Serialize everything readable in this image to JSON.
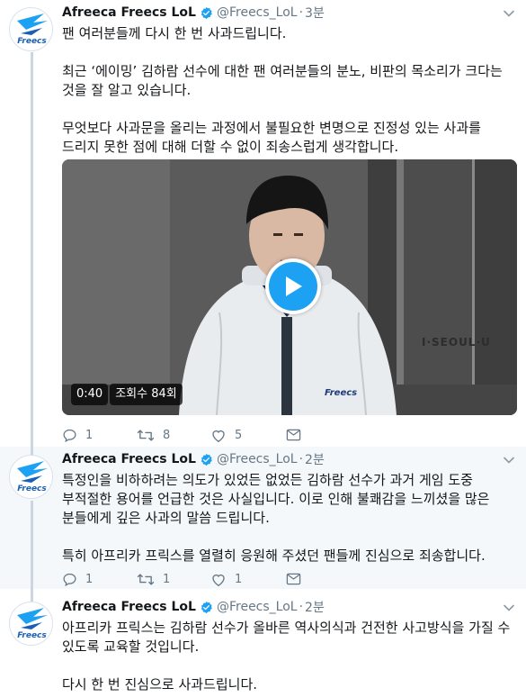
{
  "colors": {
    "accent": "#1da1f2",
    "verified": "#1da1f2",
    "thread_line": "#cbd6e2",
    "secondary_text": "#657786"
  },
  "account": {
    "name": "Afreeca Freecs LoL",
    "handle": "@Freecs_LoL",
    "logo_text": "Freecs"
  },
  "tweets": [
    {
      "time": "3분",
      "paragraphs": [
        "팬 여러분들께 다시 한 번 사과드립니다.",
        "최근 ‘에이밍’ 김하람 선수에 대한 팬 여러분들의 분노, 비판의 목소리가 크다는 것을 잘 알고 있습니다.",
        "무엇보다 사과문을 올리는 과정에서 불필요한 변명으로 진정성 있는 사과를 드리지 못한 점에 대해 더할 수 없이 죄송스럽게 생각합니다."
      ],
      "video": {
        "duration": "0:40",
        "views": "조회수 84회",
        "wall_sign": "I·SEOUL·U",
        "jacket_logo": "Freecs"
      },
      "replies": "1",
      "retweets": "8",
      "likes": "5"
    },
    {
      "time": "2분",
      "paragraphs": [
        "특정인을 비하하려는 의도가 있었든 없었든 김하람 선수가 과거 게임 도중 부적절한 용어를 언급한 것은 사실입니다. 이로 인해 불쾌감을 느끼셨을 많은 분들에게 깊은 사과의 말씀 드립니다.",
        "특히 아프리카 프릭스를 열렬히 응원해 주셨던 팬들께 진심으로 죄송합니다."
      ],
      "replies": "1",
      "retweets": "1",
      "likes": "1"
    },
    {
      "time": "2분",
      "paragraphs": [
        "아프리카 프릭스는 김하람 선수가 올바른 역사의식과 건전한 사고방식을 가질 수 있도록 교육할 것입니다.",
        "다시 한 번 진심으로 사과드립니다."
      ]
    }
  ]
}
